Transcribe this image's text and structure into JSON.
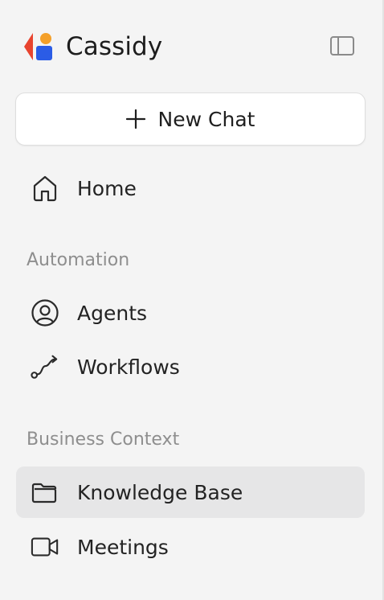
{
  "brand": {
    "name": "Cassidy",
    "logo_colors": [
      "#e8442f",
      "#f4a02a",
      "#2b5ce6"
    ]
  },
  "sidebar_toggle_icon": "sidebar-panel-icon",
  "new_chat": {
    "label": "New Chat",
    "icon": "plus-icon"
  },
  "nav": {
    "home": {
      "label": "Home",
      "icon": "home-icon"
    },
    "automation_title": "Automation",
    "agents": {
      "label": "Agents",
      "icon": "user-circle-icon"
    },
    "workflows": {
      "label": "Workflows",
      "icon": "workflow-icon"
    },
    "business_context_title": "Business Context",
    "knowledge_base": {
      "label": "Knowledge Base",
      "icon": "folder-icon",
      "active": true
    },
    "meetings": {
      "label": "Meetings",
      "icon": "video-icon"
    }
  },
  "colors": {
    "background": "#f4f4f4",
    "active_item": "#e6e6e7",
    "section_label": "#8e8e8e"
  }
}
